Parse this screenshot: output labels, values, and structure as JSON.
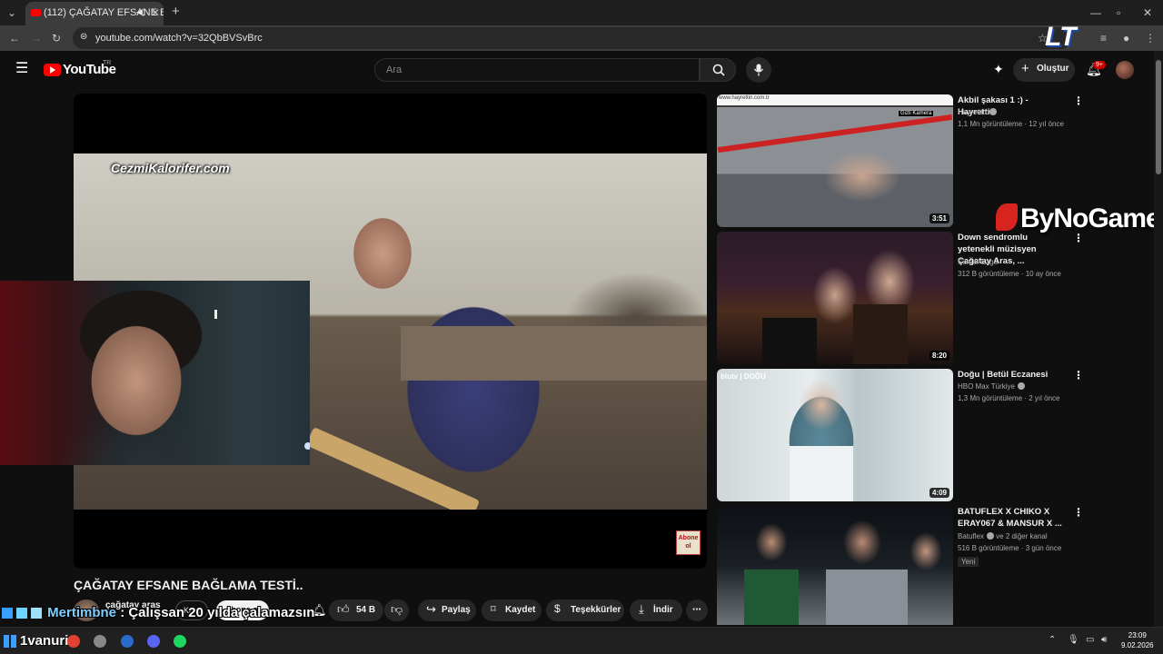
{
  "browser": {
    "tab_title": "(112) ÇAĞATAY EFSANE BA",
    "url": "youtube.com/watch?v=32QbBVSvBrc",
    "new_tab": "+",
    "tab_close": "✕"
  },
  "youtube": {
    "logo_text": "YouTube",
    "country_code": "TR",
    "search_placeholder": "Ara",
    "create_label": "Oluştur",
    "notification_count": "9+"
  },
  "video": {
    "watermark": "CezmiKalorifer.com",
    "corner_badge": "Abone ol",
    "title": "ÇAĞATAY EFSANE BAĞLAMA TESTİ..",
    "channel_name": "çağatay aras",
    "join_label": "Katıl",
    "subscribe_label": "Abone ol",
    "like_count": "54 B",
    "share_label": "Paylaş",
    "save_label": "Kaydet",
    "thanks_label": "Teşekkürler",
    "download_label": "İndir"
  },
  "chat_overlay": {
    "name": "Mertimbne",
    "message": ": Çalışsan 20 yılda çalamazsın"
  },
  "stream_overlays": {
    "sponsor": "ByNoGame",
    "streamer_logo": "LT"
  },
  "recommendations": [
    {
      "title": "Akbil şakası 1 :) - Hayrettin",
      "channel": "Hayrettin",
      "meta": "1,1 Mn görüntüleme · 12 yıl önce",
      "duration": "3:51",
      "thumb_text": "www.hayrettin.com.tr",
      "thumb_tag": "Gizli Kamera"
    },
    {
      "title": "Down sendromlu yetenekli müzisyen Çağatay Aras, ...",
      "channel": "Sümer Ezgü",
      "meta": "312 B görüntüleme · 10 ay önce",
      "duration": "8:20",
      "thumb_text": "",
      "thumb_tag": ""
    },
    {
      "title": "Doğu | Betül Eczanesi",
      "channel": "HBO Max Türkiye",
      "meta": "1,3 Mn görüntüleme · 2 yıl önce",
      "duration": "4:09",
      "thumb_text": "blutv | DOĞU",
      "thumb_tag": ""
    },
    {
      "title": "BATUFLEX X CHIKO X ERAY067 & MANSUR X ...",
      "channel": "Batuflex",
      "channel_suffix": "ve 2 diğer kanal",
      "meta": "516 B görüntüleme · 3 gün önce",
      "duration": "",
      "badge": "Yeni",
      "thumb_text": "",
      "thumb_tag": ""
    }
  ],
  "taskbar": {
    "time": "23:09",
    "date": "9.02.2026",
    "overlay_text": "1vanuri :"
  },
  "colors": {
    "youtube_red": "#ff0000",
    "background": "#0f0f0f",
    "sponsor_red": "#d8241e"
  }
}
